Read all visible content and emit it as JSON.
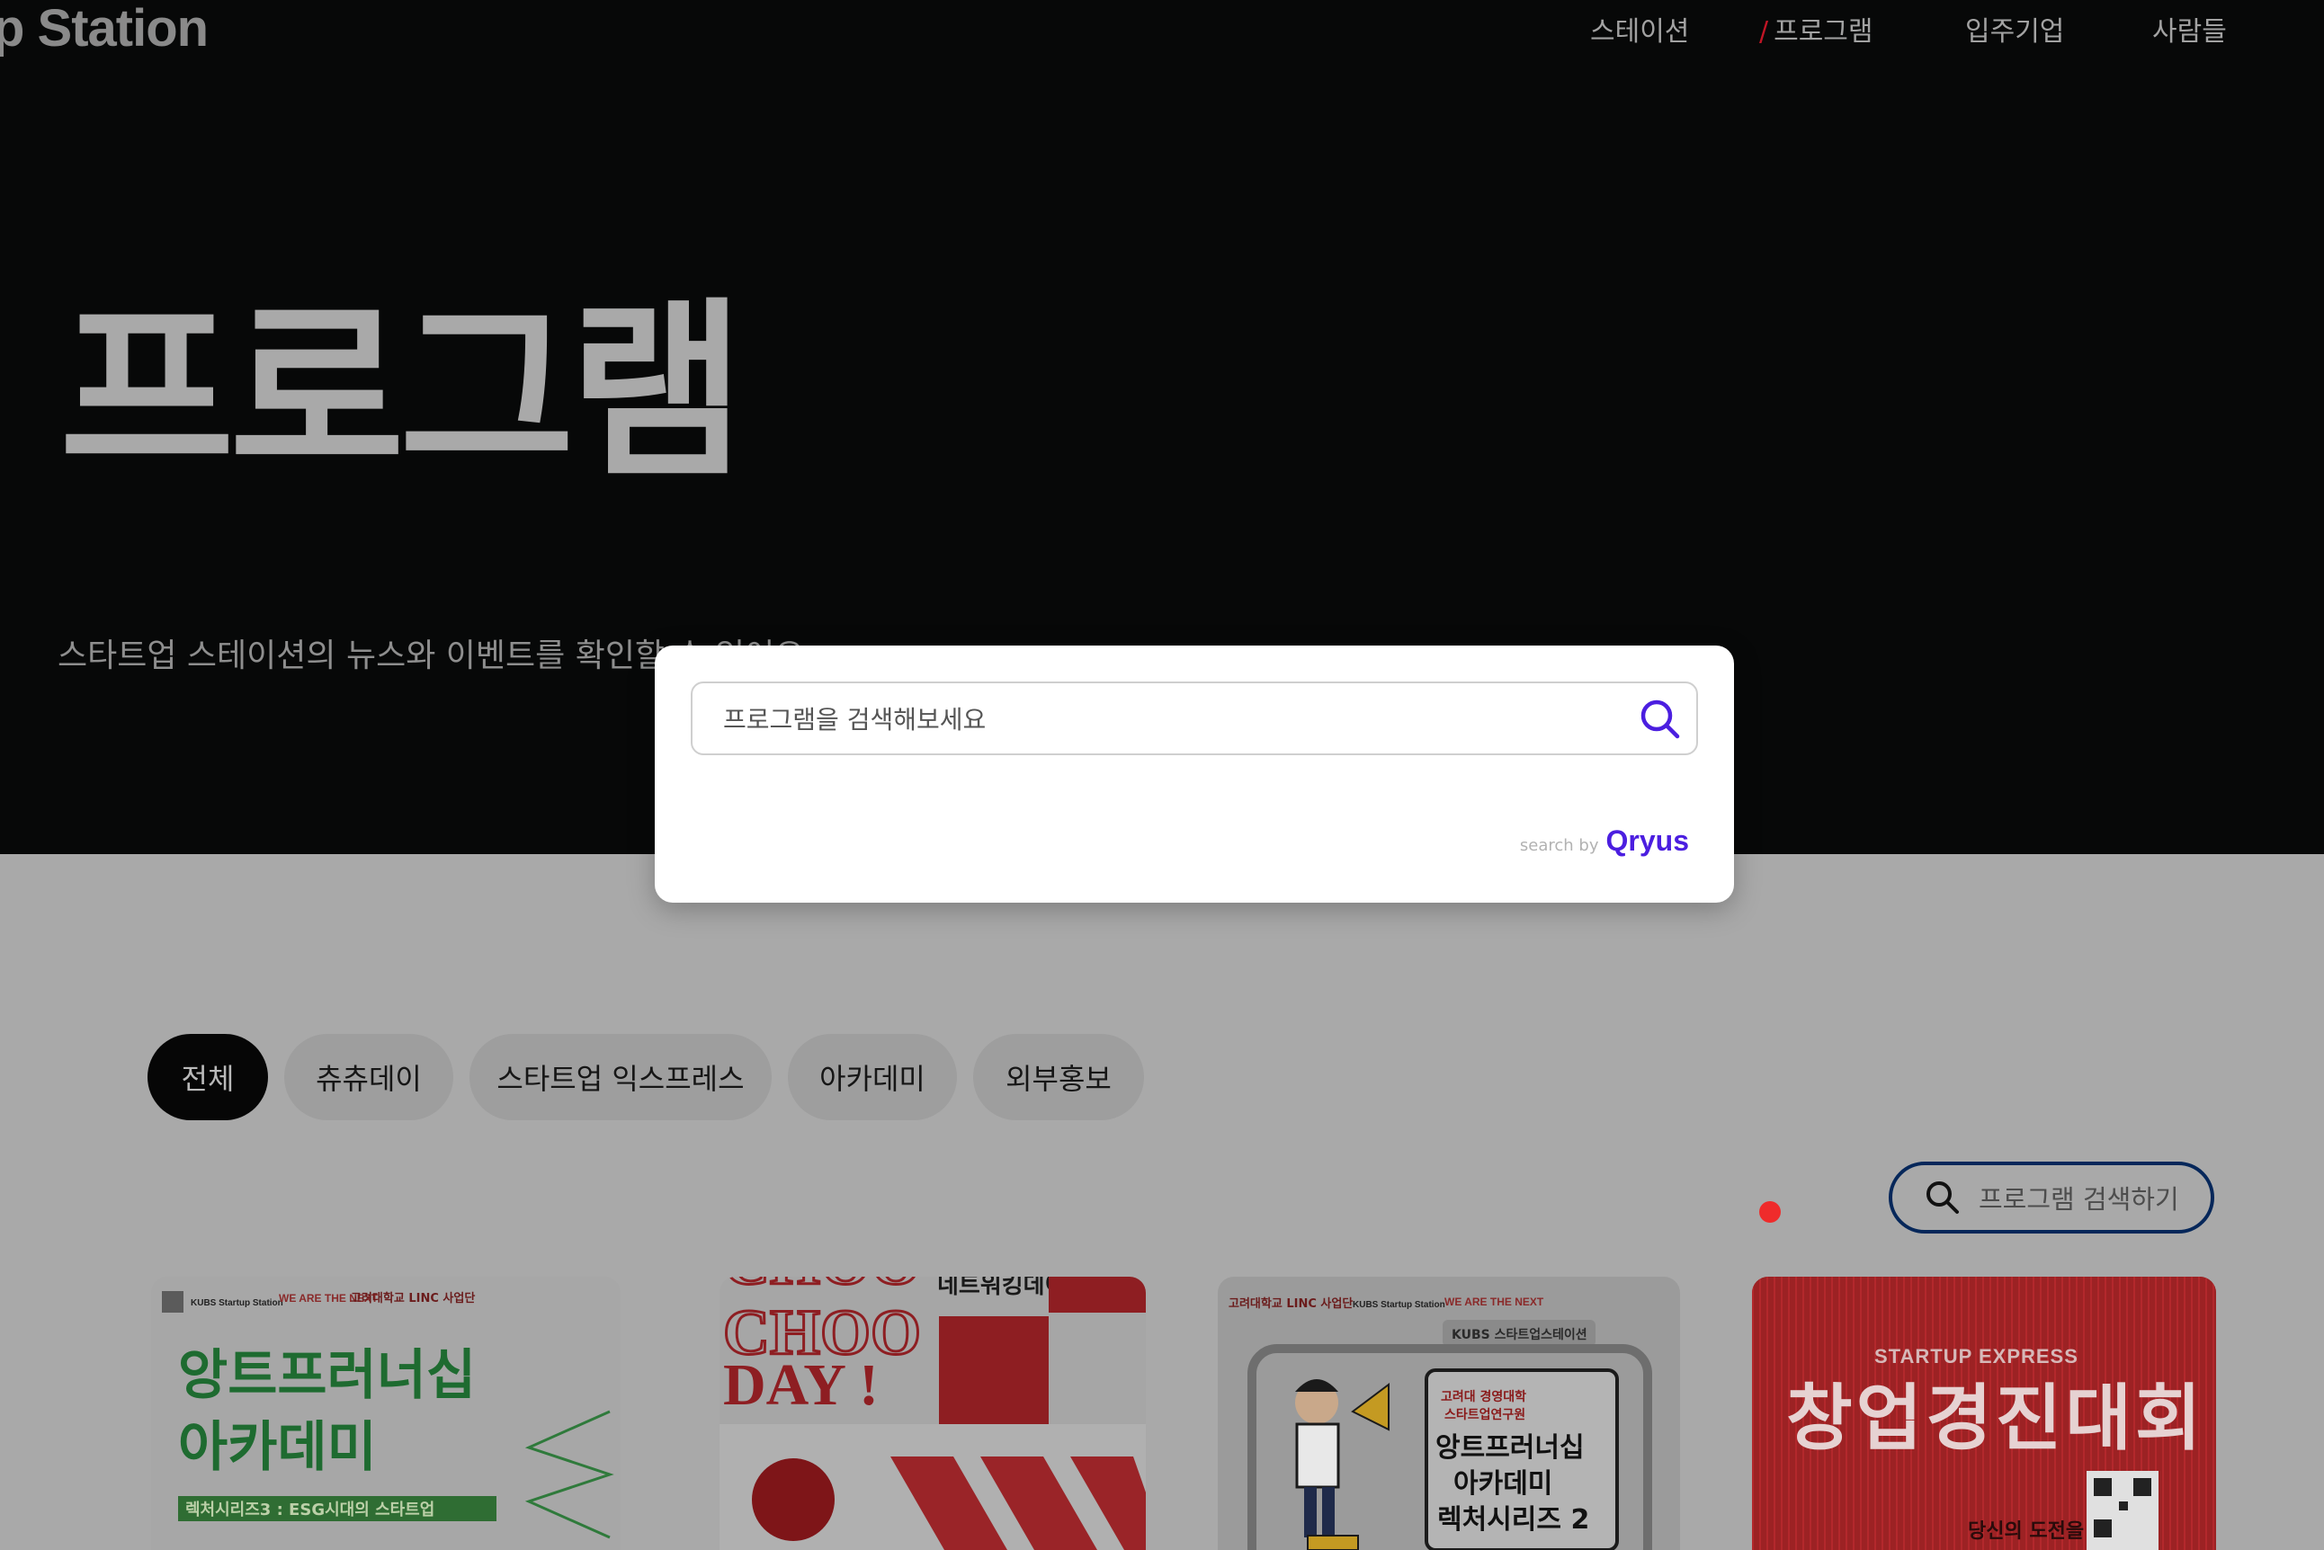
{
  "header": {
    "logo_text": "p Station",
    "nav": [
      {
        "label": "스테이션",
        "active": false
      },
      {
        "label": "프로그램",
        "active": true
      },
      {
        "label": "입주기업",
        "active": false
      },
      {
        "label": "사람들",
        "active": false
      }
    ],
    "active_marker": "/"
  },
  "hero": {
    "title": "프로그램",
    "subtitle": "스타트업 스테이션의 뉴스와 이벤트를 확인할 수 있어요"
  },
  "filters": {
    "chips": [
      "전체",
      "츄츄데이",
      "스타트업 익스프레스",
      "아카데미",
      "외부홍보"
    ],
    "selected": "전체"
  },
  "search_pill": {
    "placeholder": "프로그램 검색하기"
  },
  "search_modal": {
    "placeholder": "프로그램을 검색해보세요",
    "powered_by": "search by",
    "brand": "Qryus"
  },
  "cards": [
    {
      "logos": [
        "KUBS Startup Station",
        "WE ARE THE NEXT",
        "고려대학교 LINC 사업단"
      ],
      "headline": [
        "앙트프러너십",
        "아카데미"
      ],
      "sub": "렉처시리즈3 : ESG시대의 스타트업"
    },
    {
      "headline": [
        "CHOO",
        "CHOO",
        "DAY !"
      ],
      "tag": "네트워킹데이"
    },
    {
      "logos": [
        "고려대학교 LINC 사업단",
        "KUBS Startup Station",
        "WE ARE THE NEXT"
      ],
      "badge": "KUBS 스타트업스테이션",
      "org": [
        "고려대 경영대학",
        "스타트업연구원"
      ],
      "headline": [
        "앙트프러너십",
        "아카데미",
        "렉처시리즈 2"
      ]
    },
    {
      "kicker": "STARTUP EXPRESS",
      "headline": "창업경진대회",
      "tagline": "당신의 도전을"
    }
  ],
  "colors": {
    "accent": "#c01525",
    "brand": "#4b1ee0",
    "pill_border": "#06275a",
    "card_green": "#1e6b30",
    "card_red": "#b3282c"
  }
}
